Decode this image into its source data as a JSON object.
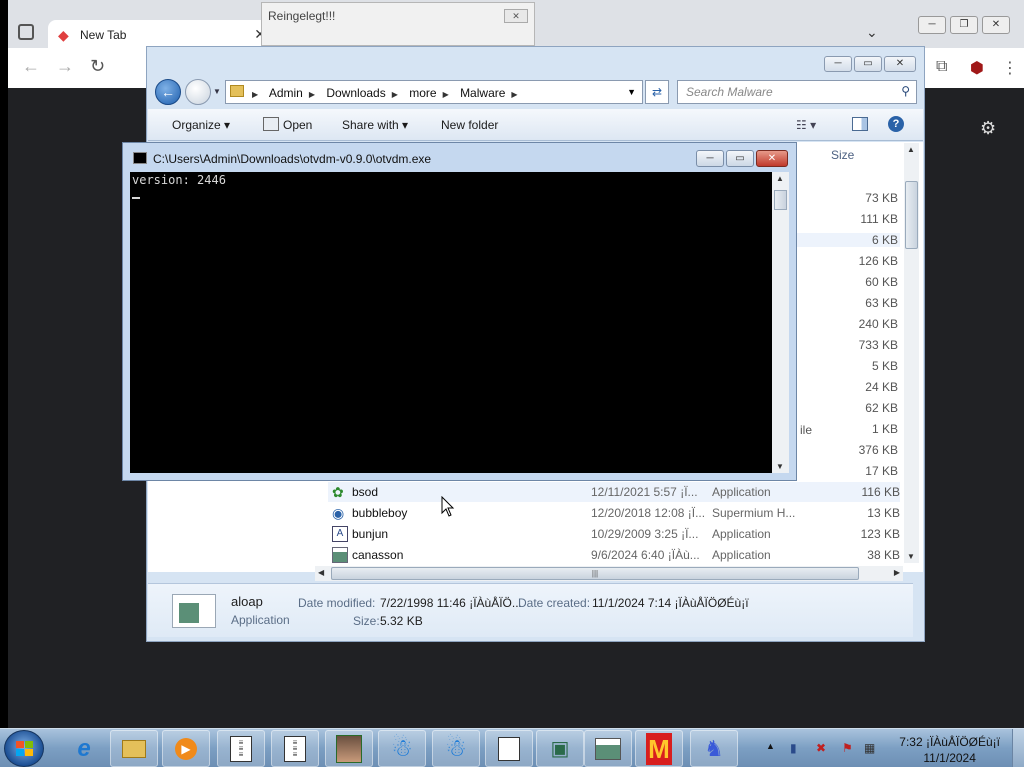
{
  "browser": {
    "tab_title": "New Tab",
    "tab_close": "✕",
    "nav_back": "←",
    "nav_forward": "→",
    "nav_reload": "↻",
    "ext_icons": [
      "puzzle-icon",
      "ublock-icon",
      "menu-icon"
    ],
    "settings_icon": "gear-icon"
  },
  "popup": {
    "title": "Reingelegt!!!",
    "close": "✕"
  },
  "explorer": {
    "breadcrumb": [
      "Admin",
      "Downloads",
      "more",
      "Malware"
    ],
    "search_placeholder": "Search Malware",
    "toolbar": {
      "organize": "Organize",
      "open": "Open",
      "share_with": "Share with",
      "new_folder": "New folder"
    },
    "column_size": "Size",
    "visible_sizes": [
      "73 KB",
      "111 KB",
      "6 KB",
      "126 KB",
      "60 KB",
      "63 KB",
      "240 KB",
      "733 KB",
      "5 KB",
      "24 KB",
      "62 KB",
      "1 KB",
      "376 KB",
      "17 KB"
    ],
    "partial_type_text": "ile",
    "files": [
      {
        "name": "bsod",
        "date": "12/11/2021 5:57 ¡Ï...",
        "type": "Application",
        "size": "116 KB",
        "icon": "frog-icon",
        "highlight": true
      },
      {
        "name": "bubbleboy",
        "date": "12/20/2018 12:08 ¡Ï...",
        "type": "Supermium H...",
        "size": "13 KB",
        "icon": "globe-icon",
        "highlight": false
      },
      {
        "name": "bunjun",
        "date": "10/29/2009 3:25 ¡Ï...",
        "type": "Application",
        "size": "123 KB",
        "icon": "exe-icon",
        "highlight": false
      },
      {
        "name": "canasson",
        "date": "9/6/2024 6:40 ¡ÏÀù...",
        "type": "Application",
        "size": "38 KB",
        "icon": "window-icon",
        "highlight": false
      }
    ],
    "details": {
      "name": "aloap",
      "kind": "Application",
      "date_modified_label": "Date modified:",
      "date_modified": "7/22/1998 11:46 ¡ÏÀùÅÏÖ...",
      "date_created_label": "Date created:",
      "date_created": "11/1/2024 7:14 ¡ÏÀùÅÏÖØÉù¡ï",
      "size_label": "Size:",
      "size": "5.32 KB"
    }
  },
  "console": {
    "title": "C:\\Users\\Admin\\Downloads\\otvdm-v0.9.0\\otvdm.exe",
    "output": "version: 2446"
  },
  "taskbar": {
    "clock_time": "7:32 ¡ÏÀùÅÏÖØÉù¡ï",
    "clock_date": "11/1/2024",
    "pinned": [
      "ie-icon",
      "folder-icon",
      "media-player-icon",
      "notepad-icon",
      "notepad-icon",
      "photo-icon",
      "blue-monster-icon",
      "blue-monster-icon",
      "otvdm-icon",
      "computer-icon",
      "window-icon",
      "mcdonalds-icon",
      "blue-figure-icon"
    ]
  },
  "colors": {
    "accent": "#2a62a8",
    "console_bg": "#000000",
    "selected_row": "#edf3fc"
  }
}
